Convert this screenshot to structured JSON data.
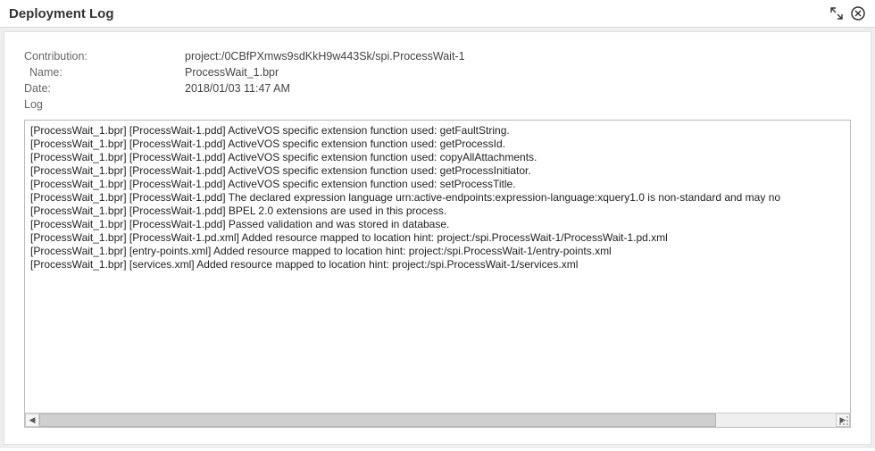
{
  "header": {
    "title": "Deployment Log"
  },
  "meta": {
    "contribution_label": "Contribution:",
    "contribution_value": "project:/0CBfPXmws9sdKkH9w443Sk/spi.ProcessWait-1",
    "name_label": "Name:",
    "name_value": "ProcessWait_1.bpr",
    "date_label": "Date:",
    "date_value": "2018/01/03 11:47 AM",
    "log_label": "Log"
  },
  "log_lines": [
    "[ProcessWait_1.bpr] [ProcessWait-1.pdd] ActiveVOS specific extension function used: getFaultString.",
    "[ProcessWait_1.bpr] [ProcessWait-1.pdd] ActiveVOS specific extension function used: getProcessId.",
    "[ProcessWait_1.bpr] [ProcessWait-1.pdd] ActiveVOS specific extension function used: copyAllAttachments.",
    "[ProcessWait_1.bpr] [ProcessWait-1.pdd] ActiveVOS specific extension function used: getProcessInitiator.",
    "[ProcessWait_1.bpr] [ProcessWait-1.pdd] ActiveVOS specific extension function used: setProcessTitle.",
    "[ProcessWait_1.bpr] [ProcessWait-1.pdd] The declared expression language urn:active-endpoints:expression-language:xquery1.0 is non-standard and may no",
    "[ProcessWait_1.bpr] [ProcessWait-1.pdd] BPEL 2.0 extensions are used in this process.",
    "[ProcessWait_1.bpr] [ProcessWait-1.pdd] Passed validation and was stored in database.",
    "[ProcessWait_1.bpr] [ProcessWait-1.pd.xml] Added resource mapped to location hint: project:/spi.ProcessWait-1/ProcessWait-1.pd.xml",
    "[ProcessWait_1.bpr] [entry-points.xml] Added resource mapped to location hint: project:/spi.ProcessWait-1/entry-points.xml",
    "[ProcessWait_1.bpr] [services.xml] Added resource mapped to location hint: project:/spi.ProcessWait-1/services.xml"
  ]
}
